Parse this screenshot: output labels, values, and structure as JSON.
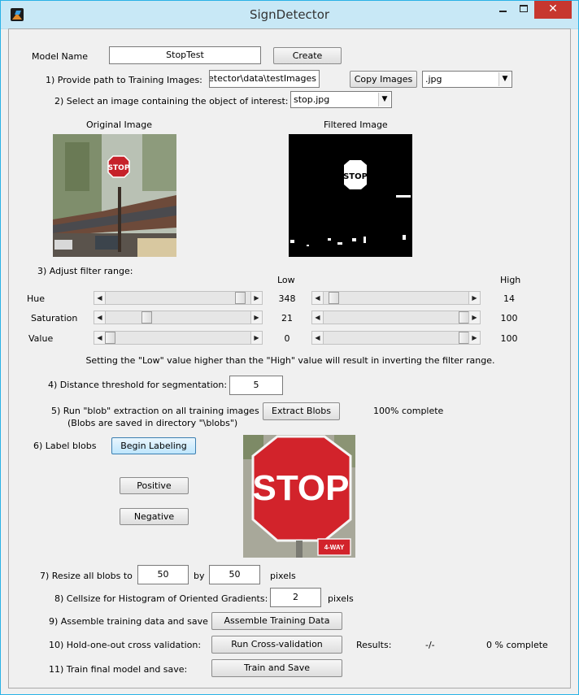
{
  "window": {
    "title": "SignDetector",
    "close_glyph": "✕"
  },
  "model": {
    "label": "Model Name",
    "value": "StopTest",
    "create_label": "Create"
  },
  "training_path": {
    "label": "1) Provide path to Training Images:",
    "value": "oadSignDetector\\data\\testImages",
    "copy_label": "Copy Images",
    "extension": ".jpg"
  },
  "select_image": {
    "label": "2) Select an image containing the object of interest:",
    "value": "stop.jpg"
  },
  "images": {
    "original_label": "Original Image",
    "filtered_label": "Filtered Image"
  },
  "filter": {
    "label": "3) Adjust filter range:",
    "low_header": "Low",
    "high_header": "High",
    "rows": [
      {
        "name": "Hue",
        "low": "348",
        "high": "14",
        "low_frac": 0.96,
        "high_frac": 0.04
      },
      {
        "name": "Saturation",
        "low": "21",
        "high": "100",
        "low_frac": 0.27,
        "high_frac": 1.0
      },
      {
        "name": "Value",
        "low": "0",
        "high": "100",
        "low_frac": 0.0,
        "high_frac": 1.0
      }
    ],
    "note": "Setting the \"Low\" value higher than the \"High\" value will result in inverting the filter range."
  },
  "distance": {
    "label": "4) Distance threshold for segmentation:",
    "value": "5"
  },
  "blob": {
    "label_line1": "5) Run \"blob\" extraction on all training images",
    "label_line2": "(Blobs are saved in directory \"\\blobs\")",
    "button": "Extract Blobs",
    "status": "100% complete"
  },
  "labeling": {
    "label": "6) Label blobs",
    "begin": "Begin Labeling",
    "positive": "Positive",
    "negative": "Negative"
  },
  "resize": {
    "label": "7) Resize all blobs to",
    "width": "50",
    "by": "by",
    "height": "50",
    "unit": "pixels"
  },
  "cellsize": {
    "label": "8) Cellsize for Histogram of Oriented Gradients:",
    "value": "2",
    "unit": "pixels"
  },
  "assemble": {
    "label": "9) Assemble training data and save",
    "button": "Assemble Training Data"
  },
  "crossval": {
    "label": "10) Hold-one-out cross validation:",
    "button": "Run Cross-validation",
    "results_label": "Results:",
    "results_value": "-/-",
    "status": "0 % complete"
  },
  "train": {
    "label": "11) Train final model and save:",
    "button": "Train and Save"
  },
  "scene": {
    "stop_sign_text": "STOP",
    "plate_text": "4-WAY"
  }
}
